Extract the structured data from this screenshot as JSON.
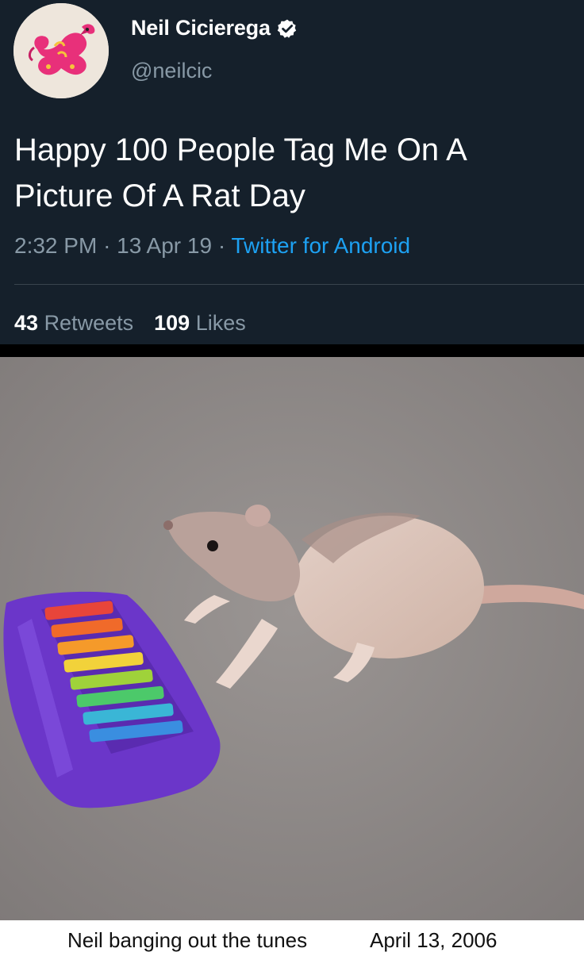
{
  "tweet": {
    "author_name": "Neil Cicierega",
    "author_handle": "@neilcic",
    "verified": true,
    "text_line1": "Happy 100 People Tag Me On A",
    "text_line2": "Picture Of A Rat Day",
    "time": "2:32 PM",
    "date": "13 Apr 19",
    "separator": "·",
    "source": "Twitter for Android",
    "retweets_count": "43",
    "retweets_label": "Retweets",
    "likes_count": "109",
    "likes_label": "Likes"
  },
  "photo": {
    "caption_text": "Neil banging out the tunes",
    "caption_date": "April 13, 2006"
  },
  "colors": {
    "tweet_bg": "#15202b",
    "secondary_text": "#8899a6",
    "link": "#1da1f2",
    "verified_badge": "#ffffff"
  },
  "icons": [
    "avatar-dragon-image",
    "verified-badge-icon"
  ]
}
